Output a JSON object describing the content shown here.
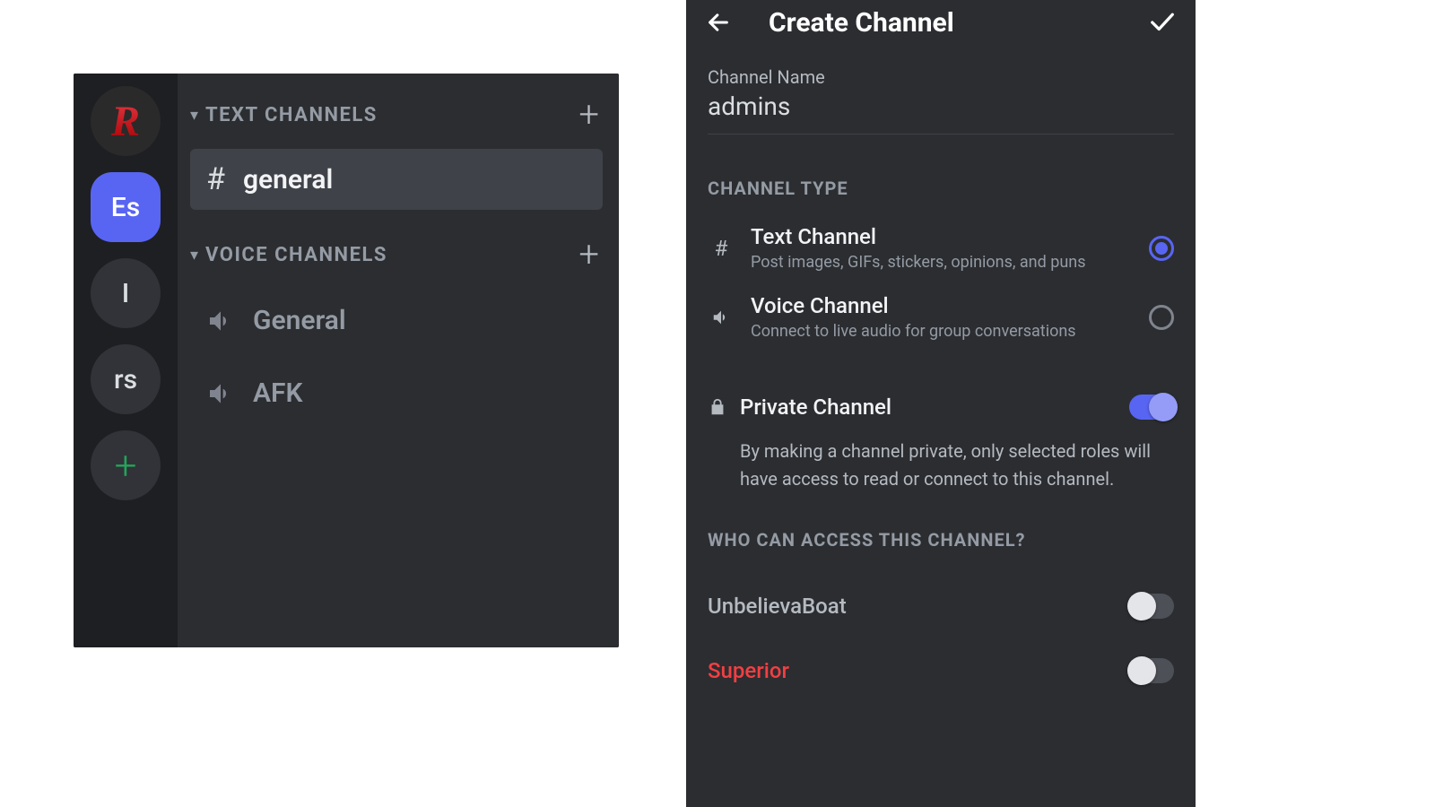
{
  "left": {
    "servers": [
      {
        "label": "R",
        "kind": "logo"
      },
      {
        "label": "Es",
        "kind": "active"
      },
      {
        "label": "I",
        "kind": "normal"
      },
      {
        "label": "rs",
        "kind": "normal"
      },
      {
        "label": "+",
        "kind": "add"
      }
    ],
    "text_section": {
      "label": "TEXT CHANNELS"
    },
    "text_channels": [
      {
        "name": "general",
        "selected": true
      }
    ],
    "voice_section": {
      "label": "VOICE CHANNELS"
    },
    "voice_channels": [
      {
        "name": "General"
      },
      {
        "name": "AFK"
      }
    ]
  },
  "right": {
    "header_title": "Create Channel",
    "channel_name_label": "Channel Name",
    "channel_name_value": "admins",
    "channel_type_title": "CHANNEL TYPE",
    "types": {
      "text": {
        "title": "Text Channel",
        "desc": "Post images, GIFs, stickers, opinions, and puns",
        "selected": true
      },
      "voice": {
        "title": "Voice Channel",
        "desc": "Connect to live audio for group conversations",
        "selected": false
      }
    },
    "private_label": "Private Channel",
    "private_on": true,
    "private_desc": "By making a channel private, only selected roles will have access to read or connect to this channel.",
    "access_title": "WHO CAN ACCESS THIS CHANNEL?",
    "roles": [
      {
        "name": "UnbelievaBoat",
        "on": false,
        "red": false
      },
      {
        "name": "Superior",
        "on": false,
        "red": true
      }
    ]
  }
}
